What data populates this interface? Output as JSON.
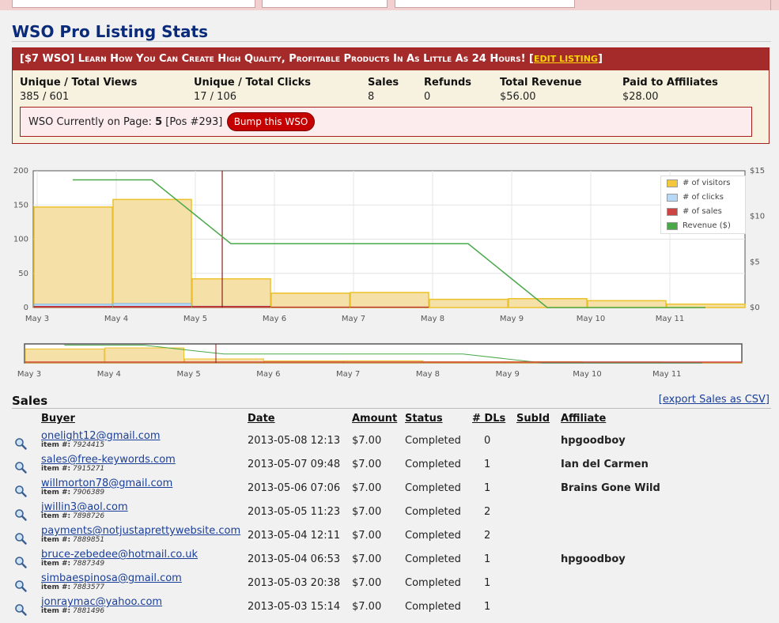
{
  "page": {
    "title": "WSO Pro Listing Stats"
  },
  "listing": {
    "name": "[$7 WSO] Learn How You Can Create High Quality, Profitable Products In As Little As 24 Hours!",
    "edit_label": "EDIT LISTING",
    "bracket_open": "[",
    "bracket_close": "]"
  },
  "stats": [
    {
      "label": "Unique / Total Views",
      "value": "385 / 601"
    },
    {
      "label": "Unique / Total Clicks",
      "value": "17 / 106"
    },
    {
      "label": "Sales",
      "value": "8"
    },
    {
      "label": "Refunds",
      "value": "0"
    },
    {
      "label": "Total Revenue",
      "value": "$56.00"
    },
    {
      "label": "Paid to Affiliates",
      "value": "$28.00"
    }
  ],
  "page_position": {
    "prefix": "WSO Currently on Page:",
    "page": "5",
    "pos": "[Pos #293]",
    "bump_label": "Bump this WSO"
  },
  "chart_data": {
    "type": "bar",
    "categories": [
      "May 3",
      "May 4",
      "May 5",
      "May 6",
      "May 7",
      "May 8",
      "May 9",
      "May 10",
      "May 11"
    ],
    "series": [
      {
        "name": "# of visitors",
        "values": [
          147,
          158,
          42,
          21,
          22,
          12,
          13,
          10,
          5
        ],
        "color": "#f2c93c"
      },
      {
        "name": "# of clicks",
        "values": [
          5,
          6,
          2,
          0,
          0,
          0,
          0,
          0,
          0
        ],
        "color": "#b6d9f7"
      },
      {
        "name": "# of sales",
        "values": [
          2,
          2,
          2,
          1,
          1,
          0,
          0,
          0,
          0
        ],
        "color": "#cc4444"
      },
      {
        "name": "Revenue ($)",
        "values": [
          14,
          14,
          7,
          7,
          7,
          7,
          0,
          0,
          0
        ],
        "color": "#4aa84a"
      }
    ],
    "ylim": [
      0,
      200
    ],
    "y_ticks": [
      "0",
      "50",
      "100",
      "150",
      "200"
    ],
    "y2lim": [
      0,
      15
    ],
    "y2_ticks": [
      "$0",
      "$5",
      "$10",
      "$15"
    ],
    "legend_position": "top-right",
    "grid": true
  },
  "sales": {
    "title": "Sales",
    "export_label": "export Sales as CSV",
    "columns": [
      "Buyer",
      "Date",
      "Amount",
      "Status",
      "# DLs",
      "SubId",
      "Affiliate"
    ],
    "item_prefix": "item #:",
    "rows": [
      {
        "buyer": "onelight12@gmail.com",
        "item": "7924415",
        "date": "2013-05-08 12:13",
        "amount": "$7.00",
        "status": "Completed",
        "dls": "0",
        "subid": "",
        "affiliate": "hpgoodboy"
      },
      {
        "buyer": "sales@free-keywords.com",
        "item": "7915271",
        "date": "2013-05-07 09:48",
        "amount": "$7.00",
        "status": "Completed",
        "dls": "1",
        "subid": "",
        "affiliate": "Ian del Carmen"
      },
      {
        "buyer": "willmorton78@gmail.com",
        "item": "7906389",
        "date": "2013-05-06 07:06",
        "amount": "$7.00",
        "status": "Completed",
        "dls": "1",
        "subid": "",
        "affiliate": "Brains Gone Wild"
      },
      {
        "buyer": "jwillin3@aol.com",
        "item": "7898726",
        "date": "2013-05-05 11:23",
        "amount": "$7.00",
        "status": "Completed",
        "dls": "2",
        "subid": "",
        "affiliate": ""
      },
      {
        "buyer": "payments@notjustaprettywebsite.com",
        "item": "7889851",
        "date": "2013-05-04 12:11",
        "amount": "$7.00",
        "status": "Completed",
        "dls": "2",
        "subid": "",
        "affiliate": ""
      },
      {
        "buyer": "bruce-zebedee@hotmail.co.uk",
        "item": "7887349",
        "date": "2013-05-04 06:53",
        "amount": "$7.00",
        "status": "Completed",
        "dls": "1",
        "subid": "",
        "affiliate": "hpgoodboy"
      },
      {
        "buyer": "simbaespinosa@gmail.com",
        "item": "7883577",
        "date": "2013-05-03 20:38",
        "amount": "$7.00",
        "status": "Completed",
        "dls": "1",
        "subid": "",
        "affiliate": ""
      },
      {
        "buyer": "jonraymac@yahoo.com",
        "item": "7881496",
        "date": "2013-05-03 15:14",
        "amount": "$7.00",
        "status": "Completed",
        "dls": "1",
        "subid": "",
        "affiliate": ""
      }
    ]
  }
}
